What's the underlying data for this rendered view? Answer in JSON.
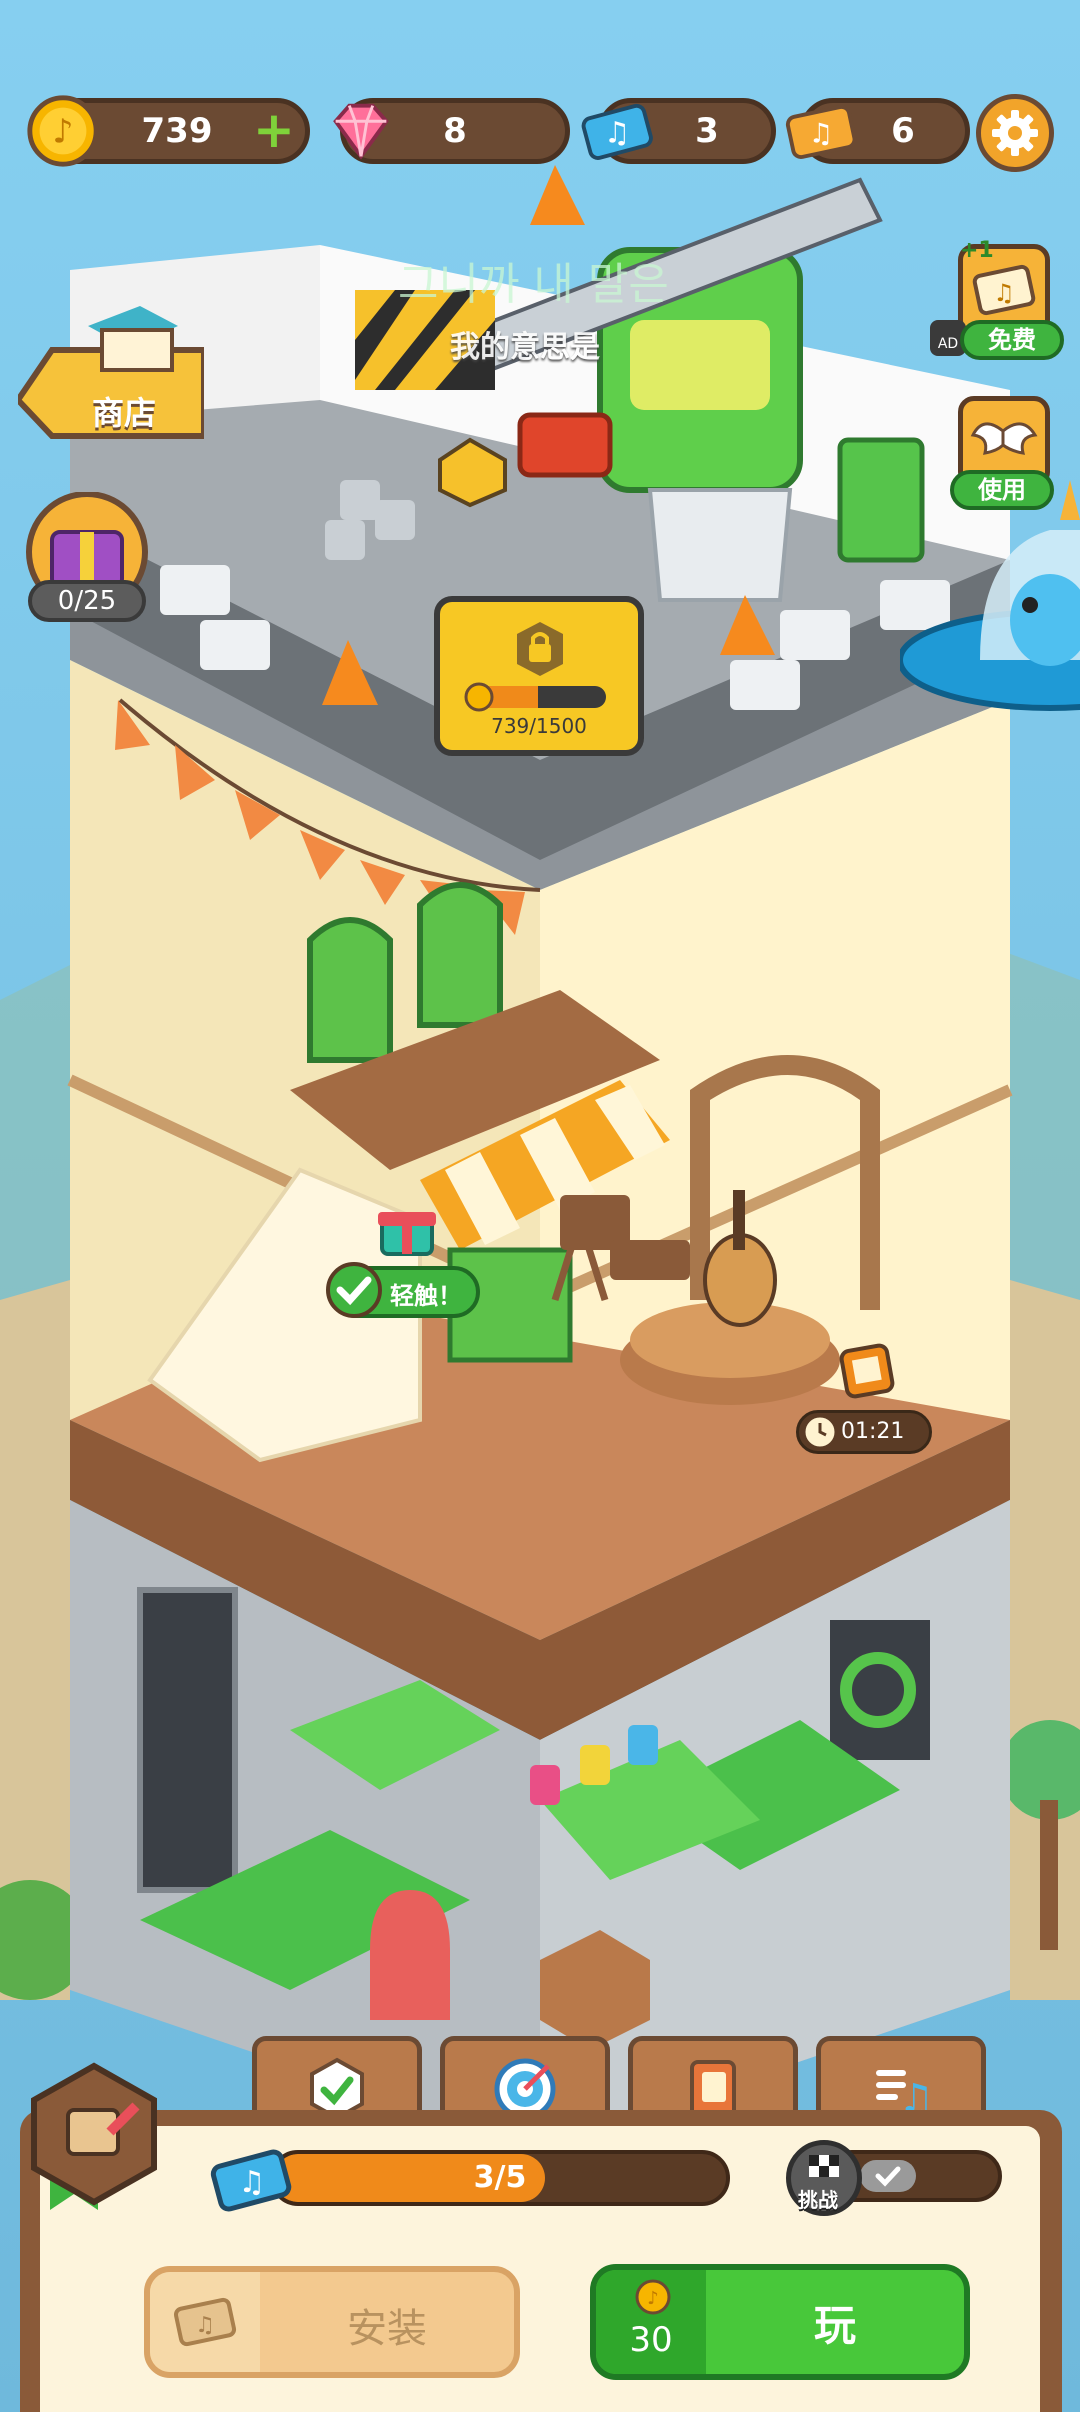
{
  "resources": {
    "coins": "739",
    "gems": "8",
    "music_tickets": "3",
    "gold_tickets": "6"
  },
  "subtitles": {
    "korean": "그니까 내 말은",
    "chinese": "我的意思是"
  },
  "shop": {
    "label": "商店"
  },
  "chest": {
    "count": "0/25"
  },
  "side_buttons": {
    "ad_reward_bonus": "+1",
    "ad_label": "AD",
    "ad_free_label": "免费",
    "wings_use_label": "使用"
  },
  "construction": {
    "progress_text": "739/1500",
    "progress": 0.493
  },
  "building": {
    "tap_label": "轻触！",
    "timer": "01:21"
  },
  "tabs": [
    "checkmark-icon",
    "target-icon",
    "notebook-icon",
    "music-list-icon"
  ],
  "bottom": {
    "ticket_progress_text": "3/5",
    "ticket_progress": 0.6,
    "challenge_label": "挑战",
    "install_label": "安装",
    "play_label": "玩",
    "play_cost": "30"
  },
  "colors": {
    "sky": "#79c7ec",
    "accent_orange": "#f08a1a",
    "accent_green": "#48c83a",
    "wood": "#8a5a39"
  }
}
